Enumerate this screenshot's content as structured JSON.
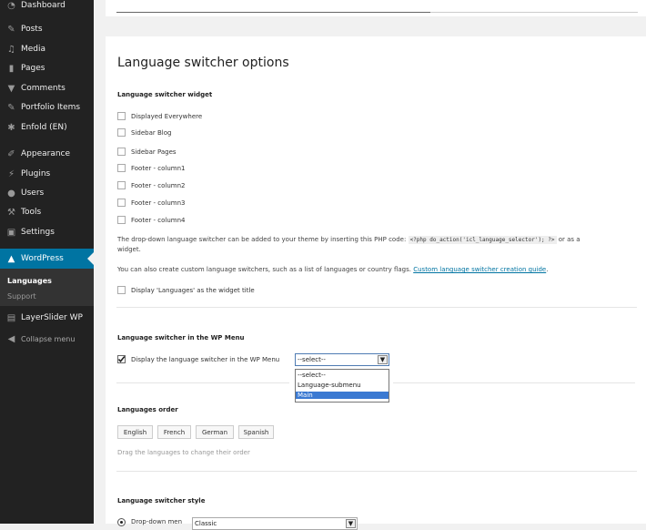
{
  "sidebar": {
    "items": [
      {
        "label": "Dashboard",
        "icon": "dashboard-icon"
      },
      {
        "label": "Posts",
        "icon": "pin-icon"
      },
      {
        "label": "Media",
        "icon": "media-icon"
      },
      {
        "label": "Pages",
        "icon": "pages-icon"
      },
      {
        "label": "Comments",
        "icon": "comments-icon"
      },
      {
        "label": "Portfolio Items",
        "icon": "pin-icon"
      },
      {
        "label": "Enfold (EN)",
        "icon": "gear-icon"
      },
      {
        "label": "Appearance",
        "icon": "brush-icon"
      },
      {
        "label": "Plugins",
        "icon": "plugin-icon"
      },
      {
        "label": "Users",
        "icon": "users-icon"
      },
      {
        "label": "Tools",
        "icon": "wrench-icon"
      },
      {
        "label": "Settings",
        "icon": "settings-icon"
      },
      {
        "label": "WordPress",
        "icon": "warning-icon"
      },
      {
        "label": "LayerSlider WP",
        "icon": "layers-icon"
      },
      {
        "label": "Collapse menu",
        "icon": "collapse-icon"
      }
    ],
    "submenu": [
      "Languages",
      "Support"
    ]
  },
  "main": {
    "section_title": "Language switcher options",
    "widget_heading": "Language switcher widget",
    "widget_options": [
      "Displayed Everywhere",
      "Sidebar Blog",
      "Sidebar Pages",
      "Footer - column1",
      "Footer - column2",
      "Footer - column3",
      "Footer - column4"
    ],
    "info_text_1": "The drop-down language switcher can be added to your theme by inserting this PHP code:",
    "code_snippet": "<?php do_action('icl_language_selector'); ?>",
    "info_text_1_tail": "or as a",
    "info_text_1_line2": "widget.",
    "info_text_2": "You can also create custom language switchers, such as a list of languages or country flags.",
    "info_link": "Custom language switcher creation guide",
    "info_text_2_tail": ".",
    "display_title_label": "Display 'Languages' as the widget title",
    "wp_menu_heading": "Language switcher in the WP Menu",
    "wp_menu_label": "Display the language switcher in the WP Menu",
    "wp_menu_select_value": "--select--",
    "wp_menu_options": [
      "--select--",
      "Language-submenu",
      "Main"
    ],
    "order_heading": "Languages order",
    "languages": [
      "English",
      "French",
      "German",
      "Spanish"
    ],
    "order_hint": "Drag the languages to change their order",
    "style_heading": "Language switcher style",
    "style_option_partial": "Drop-down men",
    "style_select_partial": "Classic"
  }
}
